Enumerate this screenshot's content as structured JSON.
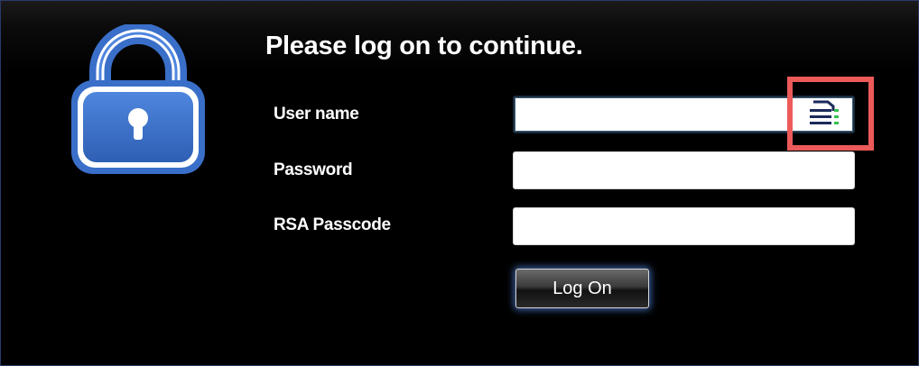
{
  "title": "Please log on to continue.",
  "fields": {
    "username": {
      "label": "User name",
      "value": ""
    },
    "password": {
      "label": "Password",
      "value": ""
    },
    "rsa_passcode": {
      "label": "RSA Passcode",
      "value": ""
    }
  },
  "logon_button": {
    "label": "Log On"
  },
  "icons": {
    "lock": "lock-icon",
    "keyboard": "virtual-keyboard-icon"
  },
  "colors": {
    "lock_blue": "#3a6fc9",
    "highlight_red": "#ec5a5a",
    "background": "#000000"
  }
}
